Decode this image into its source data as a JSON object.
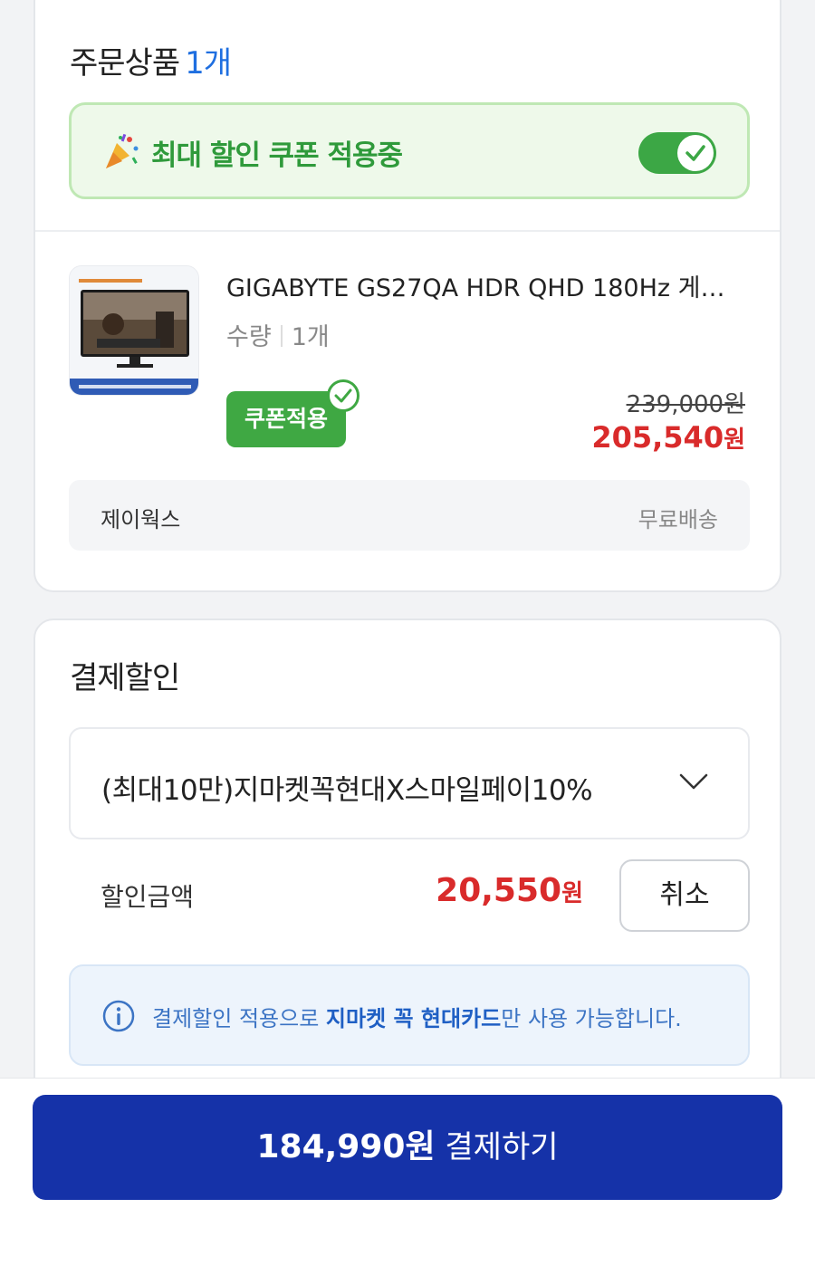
{
  "order": {
    "title": "주문상품",
    "count": "1개",
    "coupon_banner_text": "최대 할인 쿠폰 적용중",
    "coupon_toggle_on": true,
    "product": {
      "name": "GIGABYTE GS27QA HDR QHD 180Hz 게이…",
      "qty_label": "수량",
      "qty_value": "1개",
      "coupon_badge": "쿠폰적용",
      "original_price": "239,000원",
      "sale_price_number": "205,540",
      "sale_price_unit": "원"
    },
    "seller": {
      "name": "제이웍스",
      "shipping": "무료배송"
    }
  },
  "discount": {
    "title": "결제할인",
    "selected_option": "(최대10만)지마켓꼭현대X스마일페이10%",
    "amount_label": "할인금액",
    "amount_number": "20,550",
    "amount_unit": "원",
    "cancel_label": "취소",
    "info_prefix": "결제할인 적용으로 ",
    "info_bold": "지마켓 꼭 현대카드",
    "info_suffix": "만 사용 가능합니다."
  },
  "pay": {
    "amount": "184,990원",
    "label": "결제하기"
  },
  "colors": {
    "accent_blue": "#1532a8",
    "price_red": "#d92b2b",
    "coupon_green": "#3ca745"
  }
}
